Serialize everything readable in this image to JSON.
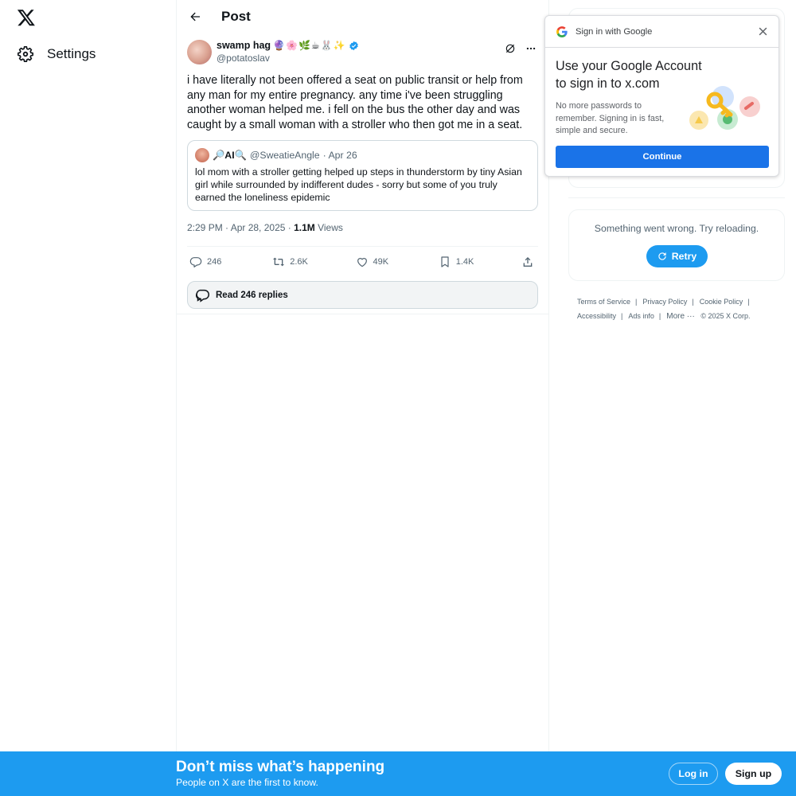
{
  "nav": {
    "logo_icon": "x-logo-icon",
    "settings_icon": "gear-icon",
    "settings_label": "Settings"
  },
  "header": {
    "title": "Post",
    "back_icon": "arrow-left-icon"
  },
  "post": {
    "display_name": "swamp hag",
    "name_emojis": "🔮🌸🌿☕🐰✨",
    "handle": "@potatoslav",
    "text": "i have literally not been offered a seat on public transit or help from any man for my entire pregnancy. any time i've been struggling another woman helped me. i fell on the bus the other day and was caught by a small woman with a stroller who then got me in a seat.",
    "quote": {
      "name": "🔎AI🔍",
      "handle": "@SweatieAngle",
      "date": "· Apr 26",
      "text": "lol mom with a stroller getting helped up steps in thunderstorm by tiny Asian girl while surrounded by indifferent dudes - sorry but some of you truly earned the loneliness epidemic"
    },
    "time": "2:29 PM · Apr 28, 2025 · ",
    "views_count": "1.1M",
    "views_label": " Views",
    "stats": {
      "replies": "246",
      "reposts": "2.6K",
      "likes": "49K",
      "bookmarks": "1.4K"
    },
    "read_replies": "Read 246 replies"
  },
  "sidebar": {
    "error_text": "Something went wrong. Try reloading.",
    "retry_label": "Retry",
    "footer": {
      "terms": "Terms of Service",
      "privacy": "Privacy Policy",
      "cookie": "Cookie Policy",
      "accessibility": "Accessibility",
      "ads": "Ads info",
      "more": "More ···",
      "copyright": "© 2025 X Corp."
    }
  },
  "google_popup": {
    "title": "Sign in with Google",
    "heading": "Use your Google Account to sign in to x.com",
    "body": "No more passwords to remember. Signing in is fast, simple and secure.",
    "continue_label": "Continue"
  },
  "banner": {
    "title": "Don’t miss what’s happening",
    "subtitle": "People on X are the first to know.",
    "login_label": "Log in",
    "signup_label": "Sign up"
  },
  "colors": {
    "x_blue": "#1d9bf0",
    "google_blue": "#1a73e8",
    "text_primary": "#0f1419",
    "text_secondary": "#536471"
  }
}
